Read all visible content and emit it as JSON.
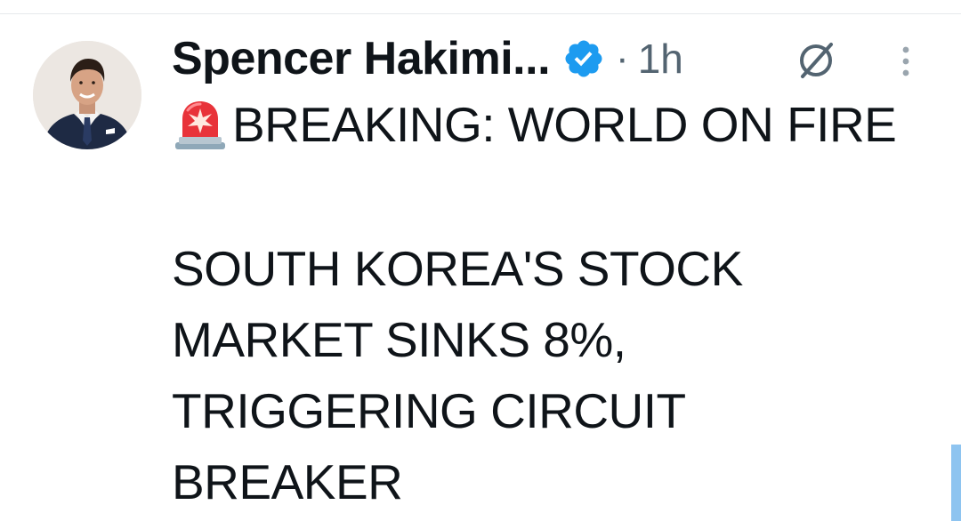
{
  "tweet": {
    "author": {
      "display_name": "Spencer Hakimi...",
      "verified": true,
      "avatar_icon": "avatar-photo"
    },
    "separator": "·",
    "timestamp": "1h",
    "headline_emoji": "police-car-light-icon",
    "headline": "BREAKING: WORLD ON FIRE",
    "body_lines": [
      "SOUTH KOREA'S STOCK",
      "MARKET SINKS 8%,",
      "TRIGGERING CIRCUIT",
      "BREAKER"
    ]
  },
  "colors": {
    "text_primary": "#0f1419",
    "text_secondary": "#536471",
    "verified_blue": "#1d9bf0",
    "divider": "#e6e9ec"
  }
}
